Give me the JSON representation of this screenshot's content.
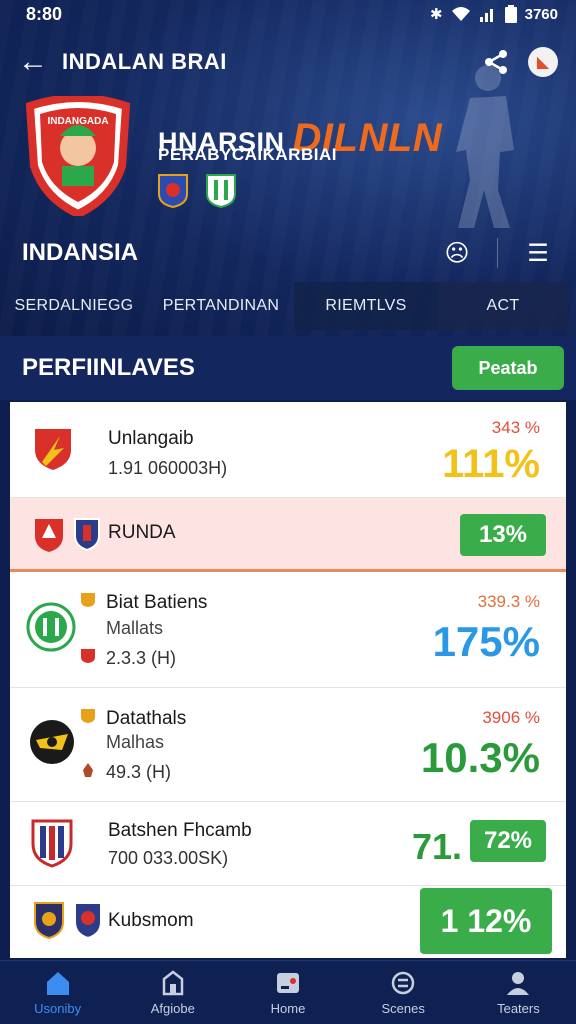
{
  "status_bar": {
    "time": "8:80",
    "battery_text": "3760"
  },
  "app_bar": {
    "title": "INDALAN BRAI"
  },
  "club": {
    "crest_text": "INDANGADA",
    "name": "HNARSIN",
    "name_accent": "DILNLN",
    "subtitle": "PERABYCAIKARBIAI"
  },
  "section": {
    "title": "INDANSIA"
  },
  "tabs": [
    "SERDALNIEGG",
    "PERTANDINAN",
    "RIEMTLVS",
    "ACT"
  ],
  "list_header": {
    "title": "PERFIINLAVES",
    "button_label": "Peatab"
  },
  "rows": [
    {
      "name": "Unlangaib",
      "meta": "1.91 060003H)",
      "small_pct": "343 %",
      "big_pct": "111%",
      "big_color": "#f2c21a",
      "crest_color": "#e8a21a"
    },
    {
      "name": "RUNDA",
      "big_pct": "13%",
      "crest_color": "#d8342a"
    },
    {
      "name": "Biat Batiens",
      "sub": "Mallats",
      "meta": "2.3.3 (H)",
      "small_pct": "339.3 %",
      "big_pct": "175%",
      "big_color": "#2a98e6",
      "crest_color": "#2aa84a"
    },
    {
      "name": "Datathals",
      "sub": "Malhas",
      "meta": "49.3 (H)",
      "small_pct": "3906 %",
      "big_pct": "10.3%",
      "big_color": "#2a9a3a",
      "crest_color": "#1a1a1a"
    },
    {
      "name": "Batshen Fhcamb",
      "meta": "700 033.00SK)",
      "big_pct": "71.",
      "pill_pct": "72%",
      "big_color": "#2a9a3a",
      "crest_color": "#c82a2a"
    },
    {
      "name": "Kubsmom",
      "big_pct": "1 12%",
      "crest_color": "#2a2f6a"
    }
  ],
  "nav": [
    {
      "label": "Usoniby",
      "icon": "home-icon"
    },
    {
      "label": "Afgiobe",
      "icon": "store-icon"
    },
    {
      "label": "Home",
      "icon": "ticket-icon"
    },
    {
      "label": "Scenes",
      "icon": "swap-icon"
    },
    {
      "label": "Teaters",
      "icon": "profile-icon"
    }
  ],
  "colors": {
    "accent_orange": "#f06a1d",
    "green": "#3aad4a",
    "navy": "#0e1f4f",
    "active_blue": "#3b8df0"
  }
}
